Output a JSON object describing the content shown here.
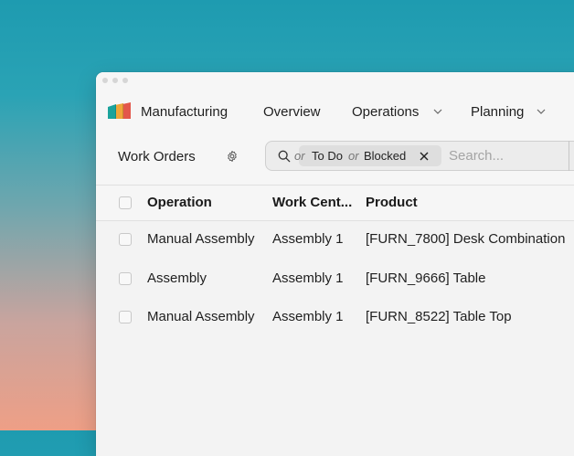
{
  "nav": {
    "app_name": "Manufacturing",
    "items": [
      {
        "label": "Overview"
      },
      {
        "label": "Operations"
      },
      {
        "label": "Planning"
      }
    ]
  },
  "control": {
    "breadcrumb": "Work Orders",
    "search": {
      "facet_partial": "or",
      "facet_value_1": "To Do",
      "facet_or": "or",
      "facet_value_2": "Blocked",
      "placeholder": "Search..."
    }
  },
  "table": {
    "columns": [
      "Operation",
      "Work Cent...",
      "Product"
    ],
    "rows": [
      [
        "Manual Assembly",
        "Assembly 1",
        "[FURN_7800] Desk Combination"
      ],
      [
        "Assembly",
        "Assembly 1",
        "[FURN_9666] Table"
      ],
      [
        "Manual Assembly",
        "Assembly 1",
        "[FURN_8522] Table Top"
      ]
    ]
  },
  "colors": {
    "logo_teal": "#1ba39c",
    "logo_orange": "#f0a53a",
    "logo_red": "#e3574b"
  }
}
